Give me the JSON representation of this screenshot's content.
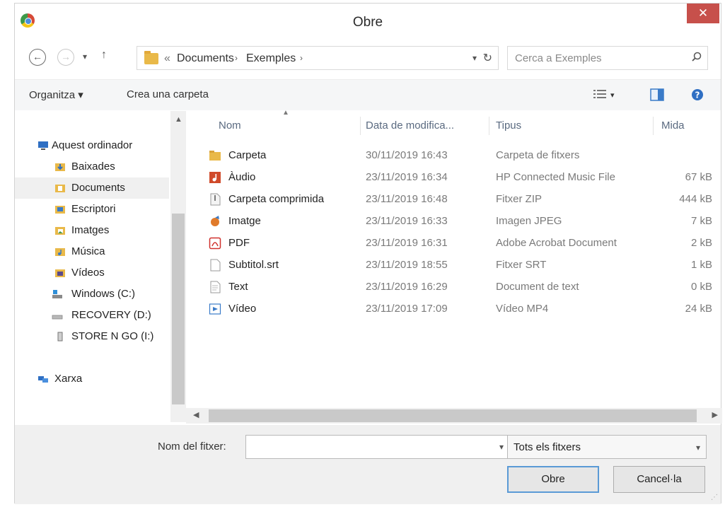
{
  "window": {
    "title": "Obre",
    "close_label": "✕"
  },
  "address": {
    "crumbs": [
      "«",
      "Documents",
      "Exemples"
    ],
    "search_placeholder": "Cerca a Exemples"
  },
  "toolbar": {
    "organize": "Organitza ▾",
    "new_folder": "Crea una carpeta"
  },
  "nav": {
    "items": [
      {
        "label": "Aquest ordinador",
        "icon": "computer-icon"
      },
      {
        "label": "Baixades",
        "icon": "downloads-folder-icon"
      },
      {
        "label": "Documents",
        "icon": "documents-folder-icon",
        "selected": true
      },
      {
        "label": "Escriptori",
        "icon": "desktop-folder-icon"
      },
      {
        "label": "Imatges",
        "icon": "pictures-folder-icon"
      },
      {
        "label": "Música",
        "icon": "music-folder-icon"
      },
      {
        "label": "Vídeos",
        "icon": "videos-folder-icon"
      },
      {
        "label": "Windows (C:)",
        "icon": "drive-icon"
      },
      {
        "label": "RECOVERY (D:)",
        "icon": "drive-icon"
      },
      {
        "label": "STORE N GO (I:)",
        "icon": "usb-drive-icon"
      },
      {
        "label": "Xarxa",
        "icon": "network-icon"
      }
    ]
  },
  "list": {
    "columns": {
      "name": "Nom",
      "date": "Data de modifica...",
      "type": "Tipus",
      "size": "Mida"
    },
    "rows": [
      {
        "name": "Carpeta",
        "date": "30/11/2019 16:43",
        "type": "Carpeta de fitxers",
        "size": "",
        "icon": "folder-icon"
      },
      {
        "name": "Àudio",
        "date": "23/11/2019 16:34",
        "type": "HP Connected Music File",
        "size": "67 kB",
        "icon": "audio-file-icon"
      },
      {
        "name": "Carpeta comprimida",
        "date": "23/11/2019 16:48",
        "type": "Fitxer ZIP",
        "size": "444 kB",
        "icon": "zip-file-icon"
      },
      {
        "name": "Imatge",
        "date": "23/11/2019 16:33",
        "type": "Imagen JPEG",
        "size": "7 kB",
        "icon": "image-file-icon"
      },
      {
        "name": "PDF",
        "date": "23/11/2019 16:31",
        "type": "Adobe Acrobat Document",
        "size": "2 kB",
        "icon": "pdf-file-icon"
      },
      {
        "name": "Subtitol.srt",
        "date": "23/11/2019 18:55",
        "type": "Fitxer SRT",
        "size": "1 kB",
        "icon": "text-file-icon"
      },
      {
        "name": "Text",
        "date": "23/11/2019 16:29",
        "type": "Document de text",
        "size": "0 kB",
        "icon": "text-file-icon"
      },
      {
        "name": "Vídeo",
        "date": "23/11/2019 17:09",
        "type": "Vídeo MP4",
        "size": "24 kB",
        "icon": "video-file-icon"
      }
    ]
  },
  "footer": {
    "filename_label": "Nom del fitxer:",
    "filename_value": "",
    "filter": "Tots els fitxers",
    "open": "Obre",
    "cancel": "Cancel·la"
  }
}
